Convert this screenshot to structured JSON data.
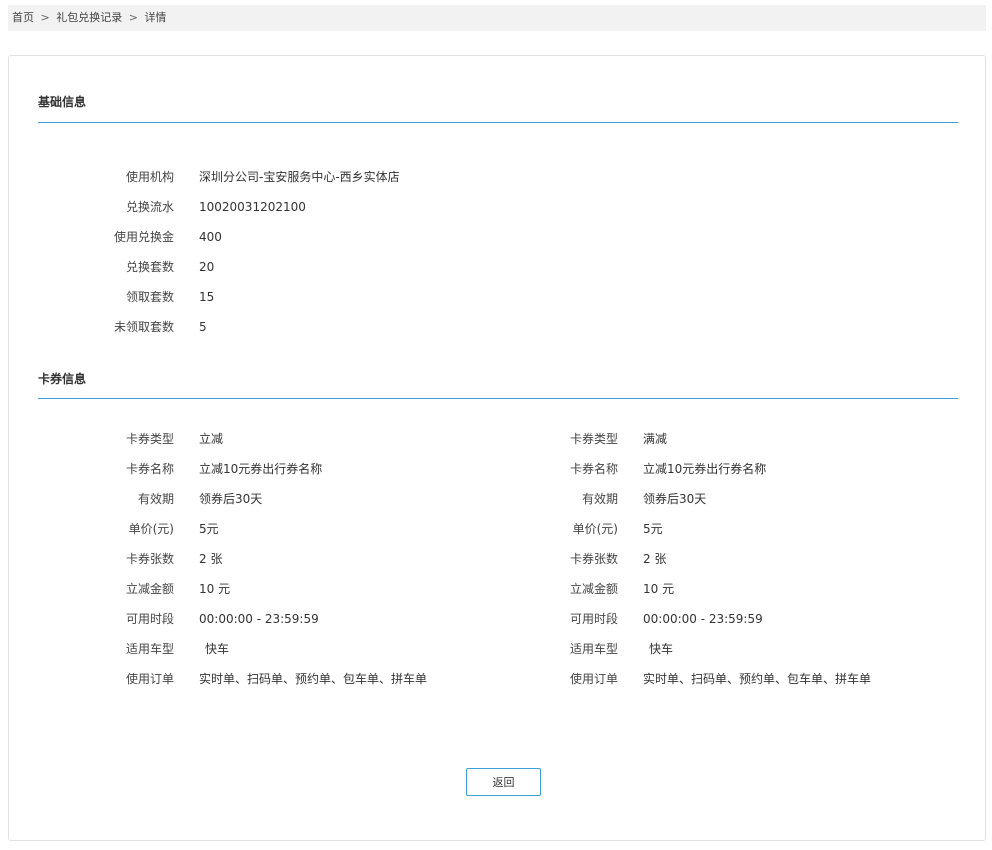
{
  "breadcrumb": {
    "home": "首页",
    "sep": ">",
    "records": "礼包兑换记录",
    "detail": "详情"
  },
  "basic": {
    "title": "基础信息",
    "fields": [
      {
        "label": "使用机构",
        "value": "深圳分公司-宝安服务中心-西乡实体店"
      },
      {
        "label": "兑换流水",
        "value": "10020031202100"
      },
      {
        "label": "使用兑换金",
        "value": "400"
      },
      {
        "label": "兑换套数",
        "value": "20"
      },
      {
        "label": "领取套数",
        "value": "15"
      },
      {
        "label": "未领取套数",
        "value": "5"
      }
    ]
  },
  "coupons": {
    "title": "卡券信息",
    "left": [
      {
        "label": "卡券类型",
        "value": "立减"
      },
      {
        "label": "卡券名称",
        "value": "立减10元券出行券名称"
      },
      {
        "label": "有效期",
        "value": "领券后30天"
      },
      {
        "label": "单价(元)",
        "value": "5元"
      },
      {
        "label": "卡券张数",
        "value": "2 张"
      },
      {
        "label": "立减金额",
        "value": "10 元"
      },
      {
        "label": "可用时段",
        "value": "00:00:00 - 23:59:59"
      },
      {
        "label": "适用车型",
        "value": "快车"
      },
      {
        "label": "使用订单",
        "value": "实时单、扫码单、预约单、包车单、拼车单"
      }
    ],
    "right": [
      {
        "label": "卡券类型",
        "value": "满减"
      },
      {
        "label": "卡券名称",
        "value": "立减10元券出行券名称"
      },
      {
        "label": "有效期",
        "value": "领券后30天"
      },
      {
        "label": "单价(元)",
        "value": "5元"
      },
      {
        "label": "卡券张数",
        "value": "2 张"
      },
      {
        "label": "立减金额",
        "value": "10 元"
      },
      {
        "label": "可用时段",
        "value": "00:00:00 - 23:59:59"
      },
      {
        "label": "适用车型",
        "value": "快车"
      },
      {
        "label": "使用订单",
        "value": "实时单、扫码单、预约单、包车单、拼车单"
      }
    ]
  },
  "actions": {
    "back_label": "返回"
  }
}
